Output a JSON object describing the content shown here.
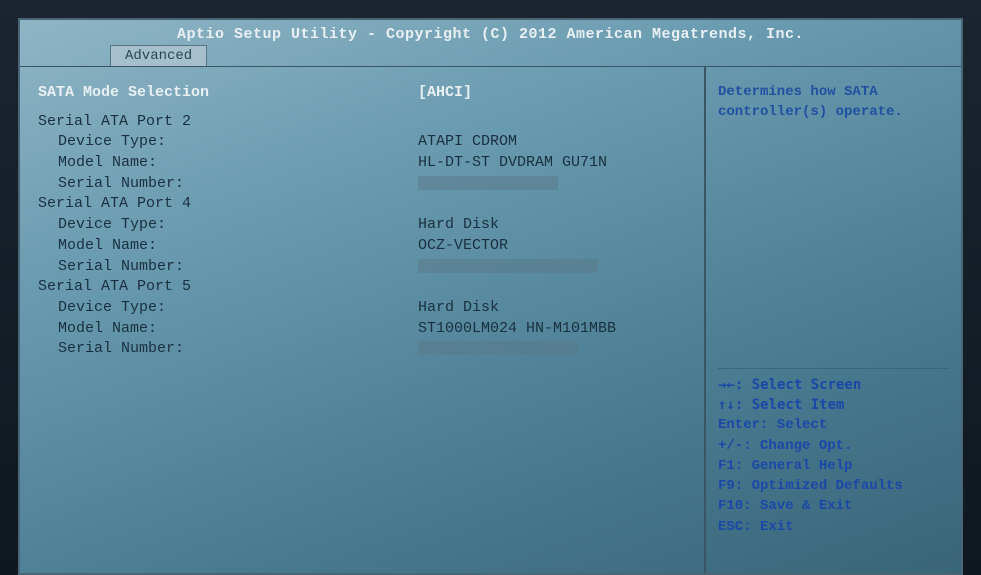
{
  "header": {
    "title": "Aptio Setup Utility - Copyright (C) 2012 American Megatrends, Inc."
  },
  "tabs": {
    "active": "Advanced"
  },
  "main": {
    "selected": {
      "label": "SATA Mode Selection",
      "value": "[AHCI]"
    },
    "ports": [
      {
        "header": "Serial ATA Port 2",
        "device_type_label": "Device Type:",
        "device_type": "ATAPI CDROM",
        "model_label": "Model Name:",
        "model": "HL-DT-ST DVDRAM GU71N",
        "serial_label": "Serial Number:",
        "serial": ""
      },
      {
        "header": "Serial ATA Port 4",
        "device_type_label": "Device Type:",
        "device_type": "Hard Disk",
        "model_label": "Model Name:",
        "model": "OCZ-VECTOR",
        "serial_label": "Serial Number:",
        "serial": ""
      },
      {
        "header": "Serial ATA Port 5",
        "device_type_label": "Device Type:",
        "device_type": "Hard Disk",
        "model_label": "Model Name:",
        "model": "ST1000LM024 HN-M101MBB",
        "serial_label": "Serial Number:",
        "serial": ""
      }
    ]
  },
  "side": {
    "help": "Determines how SATA controller(s) operate.",
    "nav": {
      "select_screen": "→←: Select Screen",
      "select_item": "↑↓: Select Item",
      "enter": "Enter: Select",
      "change": "+/-: Change Opt.",
      "f1": "F1: General Help",
      "f9": "F9: Optimized Defaults",
      "f10": "F10: Save & Exit",
      "esc": "ESC: Exit"
    }
  }
}
